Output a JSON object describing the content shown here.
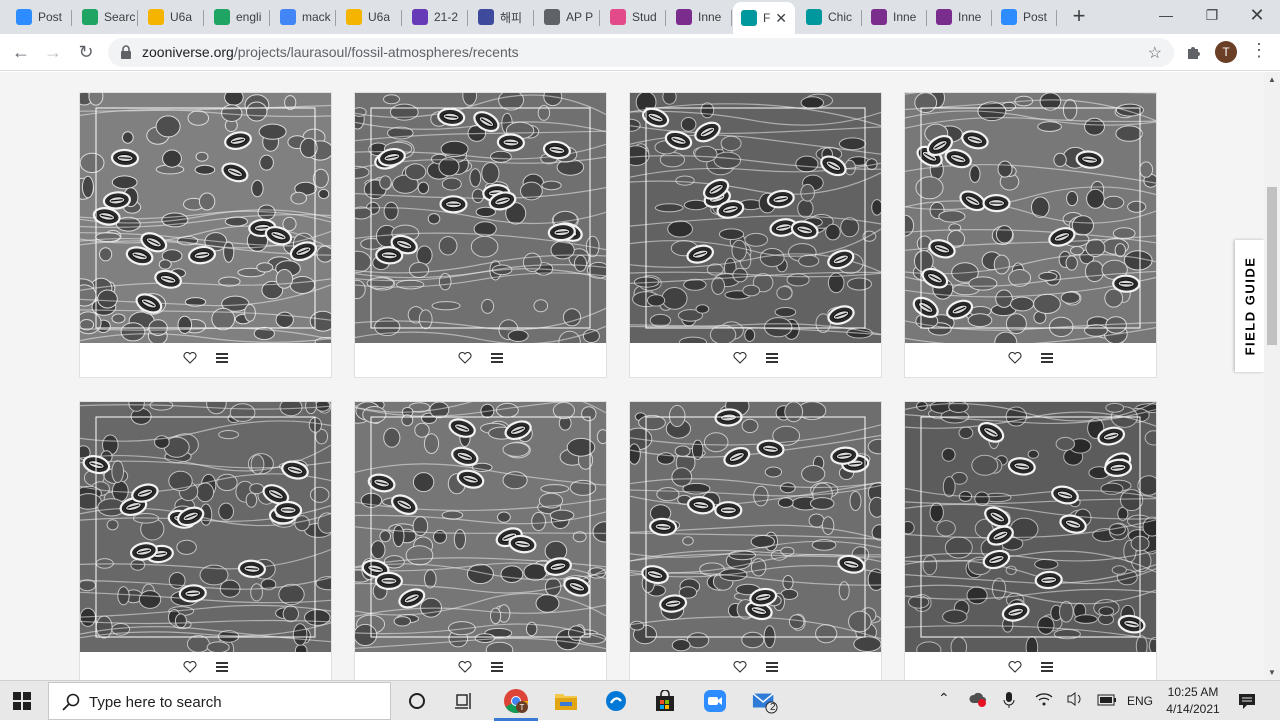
{
  "browser": {
    "tabs": [
      {
        "label": "Post",
        "icon": "zoom-icon",
        "color": "#2d8cff"
      },
      {
        "label": "Searc",
        "icon": "google-drive-icon",
        "color": "#1fa463"
      },
      {
        "label": "U6a",
        "icon": "google-slides-icon",
        "color": "#f4b400"
      },
      {
        "label": "engli",
        "icon": "google-drive-icon",
        "color": "#1fa463"
      },
      {
        "label": "mack",
        "icon": "google-docs-icon",
        "color": "#4285f4"
      },
      {
        "label": "U6a",
        "icon": "google-slides-icon",
        "color": "#f4b400"
      },
      {
        "label": "21-2",
        "icon": "google-forms-icon",
        "color": "#673ab7"
      },
      {
        "label": "해피",
        "icon": "u-icon",
        "color": "#3e4a9c"
      },
      {
        "label": "AP P",
        "icon": "shield-icon",
        "color": "#5f6368"
      },
      {
        "label": "Stud",
        "icon": "bowtie-icon",
        "color": "#e24a8a"
      },
      {
        "label": "Inne",
        "icon": "inner-icon",
        "color": "#7b2d8e"
      },
      {
        "label": "F",
        "icon": "zooniverse-icon",
        "color": "#00979d",
        "active": true
      },
      {
        "label": "Chic",
        "icon": "zooniverse-icon",
        "color": "#00979d"
      },
      {
        "label": "Inne",
        "icon": "inner-icon",
        "color": "#7b2d8e"
      },
      {
        "label": "Inne",
        "icon": "inner-icon",
        "color": "#7b2d8e"
      },
      {
        "label": "Post",
        "icon": "zoom-icon",
        "color": "#2d8cff"
      }
    ],
    "url_domain": "zooniverse.org",
    "url_path": "/projects/laurasoul/fossil-atmospheres/recents",
    "avatar_letter": "T"
  },
  "field_guide_label": "FIELD GUIDE",
  "subjects": [
    {
      "seed": 11,
      "tone": 128
    },
    {
      "seed": 23,
      "tone": 112
    },
    {
      "seed": 37,
      "tone": 98
    },
    {
      "seed": 41,
      "tone": 120
    },
    {
      "seed": 53,
      "tone": 104
    },
    {
      "seed": 67,
      "tone": 118
    },
    {
      "seed": 71,
      "tone": 110
    },
    {
      "seed": 89,
      "tone": 92
    }
  ],
  "taskbar": {
    "search_placeholder": "Type here to search",
    "language": "ENG",
    "time": "10:25 AM",
    "date": "4/14/2021",
    "mail_badge": "2"
  }
}
